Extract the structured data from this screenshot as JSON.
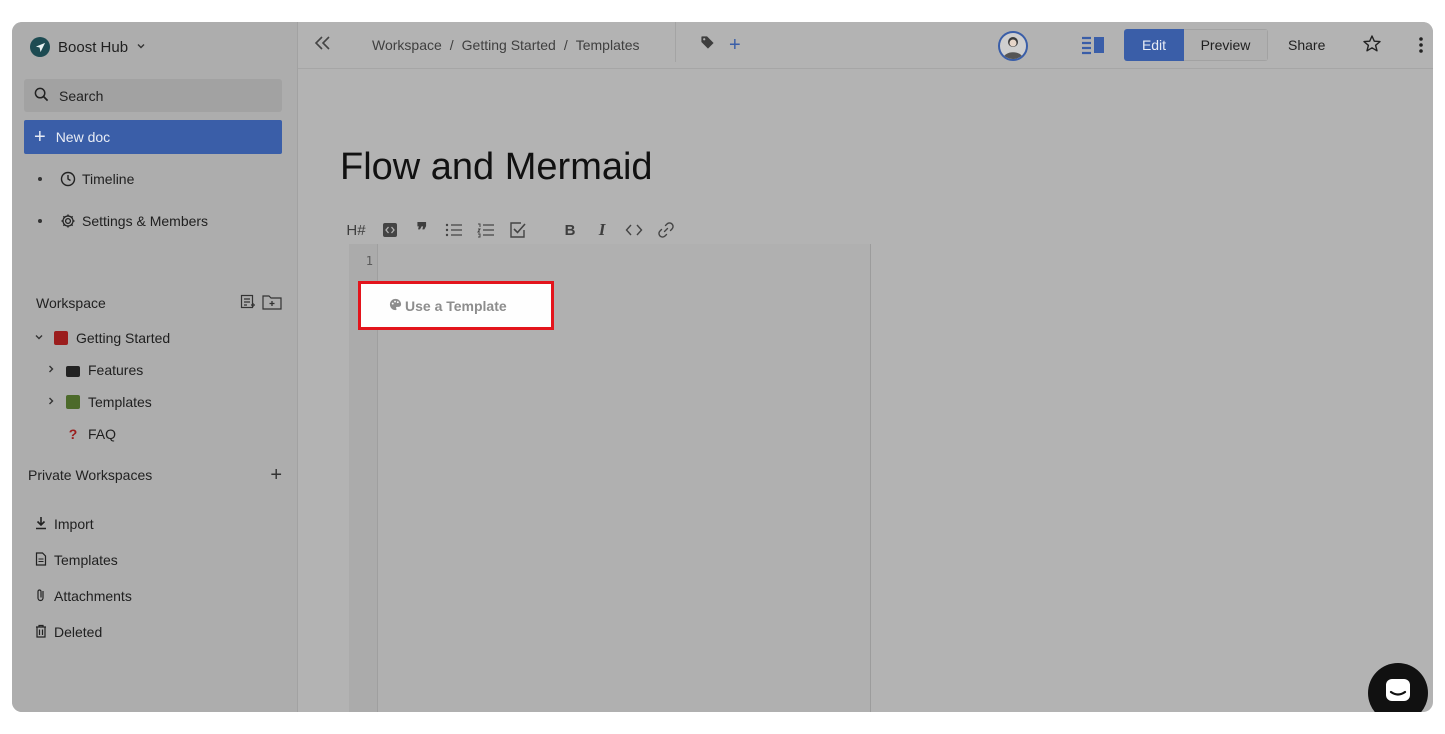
{
  "sidebar": {
    "brand": "Boost Hub",
    "search_label": "Search",
    "new_doc_label": "New doc",
    "nav": [
      {
        "label": "Timeline",
        "icon": "clock-icon"
      },
      {
        "label": "Settings & Members",
        "icon": "gear-icon"
      }
    ],
    "workspace_label": "Workspace",
    "tree": [
      {
        "label": "Getting Started",
        "expanded": true
      },
      {
        "label": "Features",
        "expanded": false
      },
      {
        "label": "Templates",
        "expanded": false
      },
      {
        "label": "FAQ"
      }
    ],
    "private_workspaces_label": "Private Workspaces",
    "bottom": [
      {
        "label": "Import",
        "icon": "download-icon"
      },
      {
        "label": "Templates",
        "icon": "file-icon"
      },
      {
        "label": "Attachments",
        "icon": "paperclip-icon"
      },
      {
        "label": "Deleted",
        "icon": "trash-icon"
      }
    ]
  },
  "topbar": {
    "breadcrumb": [
      "Workspace",
      "Getting Started",
      "Templates"
    ],
    "separator": "/",
    "edit_label": "Edit",
    "preview_label": "Preview",
    "share_label": "Share",
    "tag_plus": "+"
  },
  "document": {
    "title": "Flow and Mermaid",
    "line_number": "1",
    "use_template_label": "Use a Template"
  },
  "colors": {
    "accent": "#3a5ea8",
    "highlight_border": "#e3141c"
  }
}
